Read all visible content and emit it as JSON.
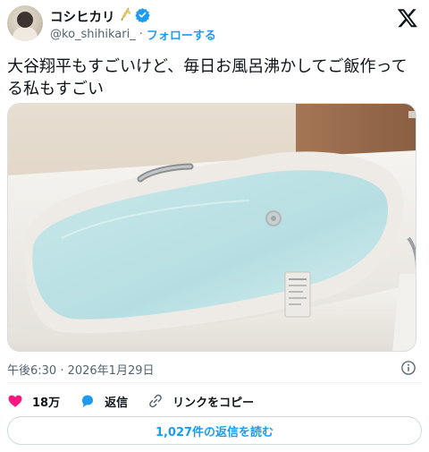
{
  "author": {
    "display_name": "コシヒカリ",
    "handle": "@ko_shihikari_",
    "separator": "·",
    "follow_label": "フォローする",
    "verified": true,
    "name_emoji_icon": "rice-sprig-icon"
  },
  "platform_logo": "x-logo-icon",
  "tweet": {
    "text_line1": "大谷翔平もすごいけど、毎日お風呂沸かしてご飯作って",
    "text_line2": "る私もすごい"
  },
  "image": {
    "subject": "photo",
    "icon": "bathtub-photo"
  },
  "meta": {
    "timestamp": "午後6:30 · 2026年1月29日"
  },
  "actions": {
    "like_count": "18万",
    "reply_label": "返信",
    "copy_link_label": "リンクをコピー"
  },
  "replies_button": {
    "label": "1,027件の返信を読む"
  },
  "colors": {
    "accent": "#1d9bf0",
    "like": "#f91880",
    "text": "#0f1419",
    "muted": "#536471"
  }
}
